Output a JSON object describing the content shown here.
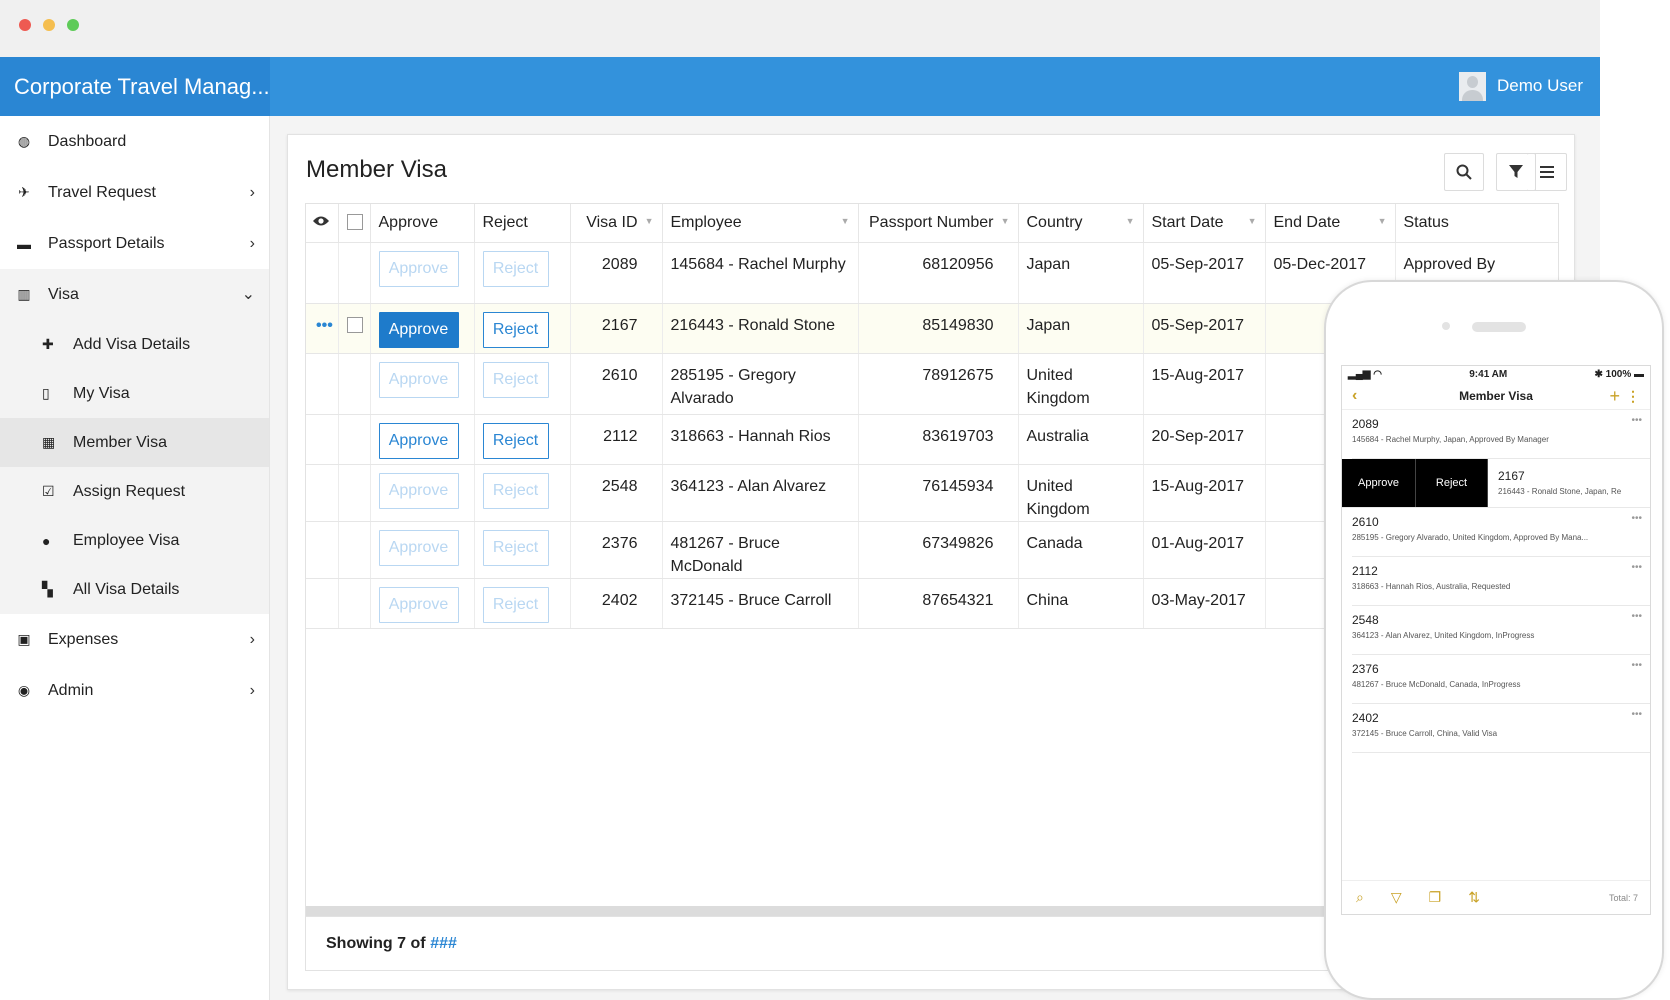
{
  "window": {
    "controls": [
      "#ee5a52",
      "#f5be4f",
      "#5ecb58"
    ]
  },
  "header": {
    "app_title": "Corporate Travel Manag...",
    "user_name": "Demo User"
  },
  "sidebar": {
    "items": [
      {
        "label": "Dashboard",
        "icon": "dashboard-icon"
      },
      {
        "label": "Travel Request",
        "icon": "plane-icon"
      },
      {
        "label": "Passport Details",
        "icon": "book-icon"
      },
      {
        "label": "Visa",
        "icon": "map-icon"
      },
      {
        "label": "Expenses",
        "icon": "money-icon"
      },
      {
        "label": "Admin",
        "icon": "lock-icon"
      }
    ],
    "visa_submenu": [
      {
        "label": "Add Visa Details",
        "icon": "plus-icon"
      },
      {
        "label": "My Visa",
        "icon": "document-icon"
      },
      {
        "label": "Member Visa",
        "icon": "table-icon"
      },
      {
        "label": "Assign Request",
        "icon": "checkbox-icon"
      },
      {
        "label": "Employee Visa",
        "icon": "users-icon"
      },
      {
        "label": "All Visa Details",
        "icon": "map-filled-icon"
      }
    ]
  },
  "main": {
    "title": "Member Visa",
    "columns": [
      "Approve",
      "Reject",
      "Visa ID",
      "Employee",
      "Passport Number",
      "Country",
      "Start Date",
      "End Date",
      "Status"
    ],
    "button_labels": {
      "approve": "Approve",
      "reject": "Reject"
    },
    "rows": [
      {
        "visa_id": "2089",
        "employee": "145684 - Rachel Murphy",
        "passport": "68120956",
        "country": "Japan",
        "start": "05-Sep-2017",
        "end": "05-Dec-2017",
        "status": "Approved By"
      },
      {
        "visa_id": "2167",
        "employee": "216443 - Ronald Stone",
        "passport": "85149830",
        "country": "Japan",
        "start": "05-Sep-2017",
        "end": "",
        "status": ""
      },
      {
        "visa_id": "2610",
        "employee": "285195 - Gregory Alvarado",
        "passport": "78912675",
        "country": "United Kingdom",
        "start": "15-Aug-2017",
        "end": "",
        "status": ""
      },
      {
        "visa_id": "2112",
        "employee": "318663 - Hannah Rios",
        "passport": "83619703",
        "country": "Australia",
        "start": "20-Sep-2017",
        "end": "",
        "status": ""
      },
      {
        "visa_id": "2548",
        "employee": "364123 - Alan Alvarez",
        "passport": "76145934",
        "country": "United Kingdom",
        "start": "15-Aug-2017",
        "end": "",
        "status": ""
      },
      {
        "visa_id": "2376",
        "employee": "481267 - Bruce McDonald",
        "passport": "67349826",
        "country": "Canada",
        "start": "01-Aug-2017",
        "end": "",
        "status": ""
      },
      {
        "visa_id": "2402",
        "employee": "372145 - Bruce Carroll",
        "passport": "87654321",
        "country": "China",
        "start": "03-May-2017",
        "end": "",
        "status": ""
      }
    ],
    "footer": {
      "prefix": "Showing 7 of",
      "total": "###"
    }
  },
  "mobile": {
    "time": "9:41 AM",
    "battery": "100%",
    "title": "Member Visa",
    "swipe_approve": "Approve",
    "swipe_reject": "Reject",
    "items": [
      {
        "id": "2089",
        "desc": "145684 - Rachel  Murphy, Japan, Approved By Manager"
      },
      {
        "id": "2167",
        "desc": "216443 - Ronald  Stone, Japan, Re"
      },
      {
        "id": "2610",
        "desc": "285195 - Gregory  Alvarado, United Kingdom, Approved By Mana..."
      },
      {
        "id": "2112",
        "desc": "318663 - Hannah  Rios, Australia, Requested"
      },
      {
        "id": "2548",
        "desc": "364123 - Alan  Alvarez, United Kingdom, InProgress"
      },
      {
        "id": "2376",
        "desc": "481267 - Bruce  McDonald, Canada, InProgress"
      },
      {
        "id": "2402",
        "desc": "372145 - Bruce  Carroll, China, Valid Visa"
      }
    ],
    "total": "Total: 7"
  }
}
